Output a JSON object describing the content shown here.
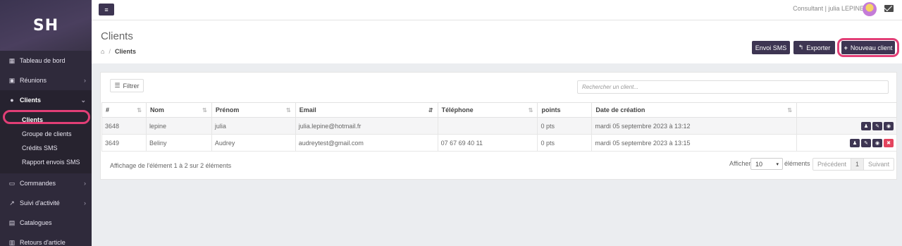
{
  "sidebar": {
    "logo": "SH",
    "items": [
      {
        "label": "Tableau de bord",
        "icon": "dashboard-icon"
      },
      {
        "label": "Réunions",
        "icon": "calendar-icon"
      },
      {
        "label": "Clients",
        "icon": "users-icon"
      },
      {
        "label": "Commandes",
        "icon": "card-icon"
      },
      {
        "label": "Suivi d'activité",
        "icon": "chart-icon"
      },
      {
        "label": "Catalogues",
        "icon": "book-icon"
      },
      {
        "label": "Retours d'article",
        "icon": "return-icon"
      }
    ],
    "sub_items": [
      "Clients",
      "Groupe de clients",
      "Crédits SMS",
      "Rapport envois SMS"
    ]
  },
  "topbar": {
    "role": "Consultant |",
    "user_name": "julia LEPINE"
  },
  "header": {
    "title": "Clients",
    "breadcrumb_current": "Clients",
    "btn_sms": "Envoi SMS",
    "btn_export": "Exporter",
    "btn_new": "Nouveau client"
  },
  "table": {
    "filter_label": "Filtrer",
    "search_placeholder": "Rechercher un client...",
    "columns": [
      "#",
      "Nom",
      "Prénom",
      "Email",
      "Téléphone",
      "points",
      "Date de création"
    ],
    "rows": [
      {
        "id": "3648",
        "nom": "lepine",
        "prenom": "julia",
        "email": "julia.lepine@hotmail.fr",
        "tel": "",
        "points": "0 pts",
        "date": "mardi 05 septembre 2023 à 13:12"
      },
      {
        "id": "3649",
        "nom": "Beliny",
        "prenom": "Audrey",
        "email": "audreytest@gmail.com",
        "tel": "07 67 69 40 11",
        "points": "0 pts",
        "date": "mardi 05 septembre 2023 à 13:15"
      }
    ],
    "info": "Affichage de l'élément 1 à 2 sur 2 éléments",
    "afficher": "Afficher",
    "page_size": "10",
    "elements": "éléments",
    "prev": "Précédent",
    "page": "1",
    "next": "Suivant"
  },
  "colors": {
    "sidebar_bg": "#2f2a3b",
    "primary": "#3d3552",
    "highlight": "#e23e76",
    "danger": "#e3445e"
  }
}
